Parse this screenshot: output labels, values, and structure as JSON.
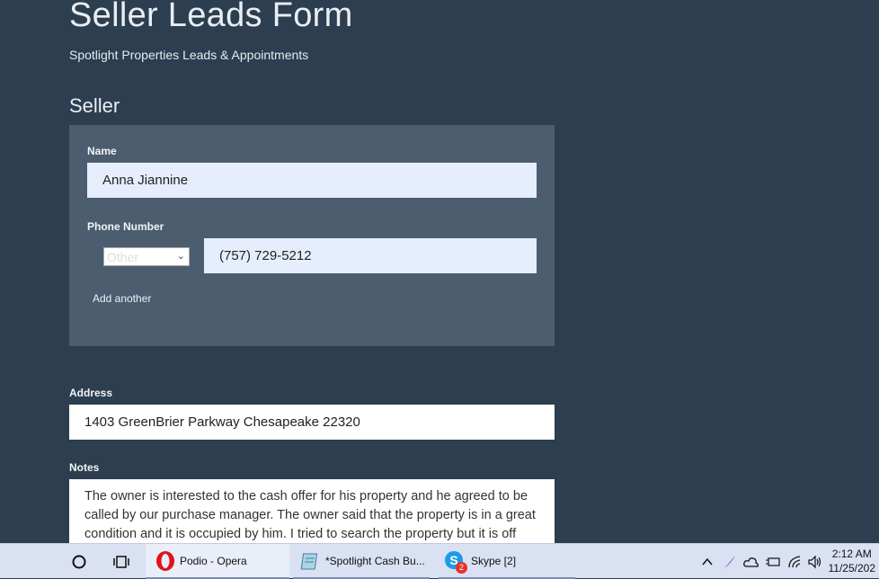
{
  "form": {
    "title": "Seller Leads Form",
    "subtitle": "Spotlight Properties Leads & Appointments",
    "section_title": "Seller",
    "name_label": "Name",
    "name_value": "Anna Jiannine",
    "phone_label": "Phone Number",
    "phone_type": "Other",
    "phone_value": "(757) 729-5212",
    "add_another": "Add another",
    "address_label": "Address",
    "address_value": "1403 GreenBrier Parkway Chesapeake  22320",
    "notes_label": "Notes",
    "notes_value": "The owner is interested to the cash offer for his property and he agreed to be called by our purchase manager. The owner said that the property is in a great condition and it is occupied by him. I tried to search the property but it is off"
  },
  "taskbar": {
    "opera_label": "Podio - Opera",
    "notepad_label": "*Spotlight Cash Bu...",
    "skype_label": "Skype [2]",
    "skype_badge": "2",
    "time": "2:12 AM",
    "date": "11/25/202"
  },
  "colors": {
    "background": "#2c3e50",
    "panel": "#4b5d6f",
    "input_blue": "#e6eefe",
    "taskbar": "#d9e1f2"
  }
}
